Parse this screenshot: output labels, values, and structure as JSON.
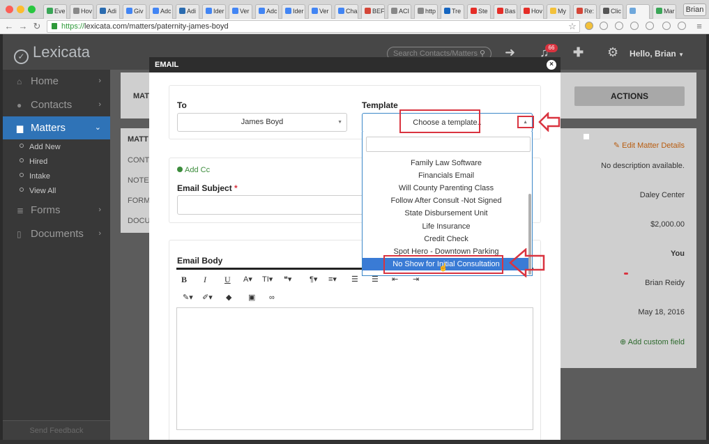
{
  "browser": {
    "tabs": [
      "Eve",
      "Hov",
      "Adi",
      "Giv",
      "Adc",
      "Adi",
      "Ider",
      "Ver",
      "Adc",
      "Ider",
      "Ver",
      "Cha",
      "BEF",
      "ACI",
      "http",
      "Tre",
      "Ste",
      "Bas",
      "Hov",
      "My",
      "Re:",
      "Clic",
      "",
      "Mar"
    ],
    "profile": "Brian",
    "url_scheme": "https://",
    "url_rest": "lexicata.com/matters/paternity-james-boyd"
  },
  "app": {
    "logo": "Lexicata",
    "search_placeholder": "Search Contacts/Matters",
    "notification_count": "66",
    "user_greeting": "Hello, Brian"
  },
  "sidebar": {
    "items": [
      {
        "label": "Home",
        "icon": "home-icon"
      },
      {
        "label": "Contacts",
        "icon": "user-icon"
      },
      {
        "label": "Matters",
        "icon": "briefcase-icon"
      },
      {
        "label": "Forms",
        "icon": "list-icon"
      },
      {
        "label": "Documents",
        "icon": "file-icon"
      }
    ],
    "sub_items": [
      "Add New",
      "Hired",
      "Intake",
      "View All"
    ],
    "feedback": "Send Feedback"
  },
  "background_page": {
    "title_partial": "MAT",
    "section_partial": "MATT",
    "labels": [
      "CONT",
      "NOTES",
      "FORM",
      "DOCU"
    ],
    "actions_label": "ACTIONS",
    "edit_link": "Edit Matter Details",
    "values": [
      "No description available.",
      "Daley Center",
      "$2,000.00",
      "You",
      "Brian Reidy",
      "May 18, 2016"
    ],
    "add_custom_field": "Add custom field"
  },
  "modal": {
    "title": "EMAIL",
    "close": "×",
    "to_label": "To",
    "to_value": "James Boyd",
    "template_label": "Template",
    "template_placeholder": "Choose a template..",
    "add_cc": "Add Cc",
    "subject_label": "Email Subject",
    "required_mark": "*",
    "body_label": "Email Body",
    "toolbar": [
      "B",
      "I",
      "U",
      "A▾",
      "TI▾",
      "❝▾",
      "¶▾",
      "≡▾",
      "☰",
      "☰",
      "⇤",
      "⇥",
      "✎▾",
      "✐▾",
      "◆",
      "▣",
      "∞"
    ]
  },
  "dropdown": {
    "options": [
      "Family Law Software",
      "Financials Email",
      "Will County Parenting Class",
      "Follow After Consult -Not Signed",
      "State Disbursement Unit",
      "Life Insurance",
      "Credit Check",
      "Spot Hero - Downtown Parking",
      "No Show for Initial Consultation"
    ],
    "highlighted_index": 8
  },
  "colors": {
    "accent": "#2f73b7",
    "highlight": "#3a7bd5",
    "annotation_red": "#d9333f"
  }
}
